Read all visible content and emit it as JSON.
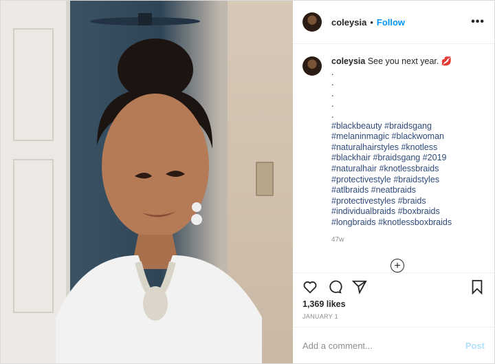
{
  "post": {
    "username": "coleysia",
    "separator": "•",
    "follow_label": "Follow",
    "more_label": "•••",
    "caption_text": "See you next year.",
    "caption_emoji": "💋",
    "caption_dots": [
      ".",
      ".",
      ".",
      ".",
      "."
    ],
    "hashtags": [
      "#blackbeauty #braidsgang",
      "#melaninmagic #blackwoman",
      "#naturalhairstyles #knotless",
      "#blackhair #braidsgang #2019",
      "#naturalhair #knotlessbraids",
      "#protectivestyle #braidstyles",
      "#atlbraids #neatbraids",
      "#protectivestyles #braids",
      "#individualbraids #boxbraids",
      "#longbraids #knotlessboxbraids"
    ],
    "time_ago": "47w",
    "likes": "1,369 likes",
    "date": "JANUARY 1",
    "comment_placeholder": "Add a comment...",
    "post_label": "Post"
  },
  "icons": {
    "more_comments": "plus-circle-icon",
    "like": "heart-icon",
    "comment": "comment-icon",
    "share": "paper-plane-icon",
    "save": "bookmark-icon"
  }
}
